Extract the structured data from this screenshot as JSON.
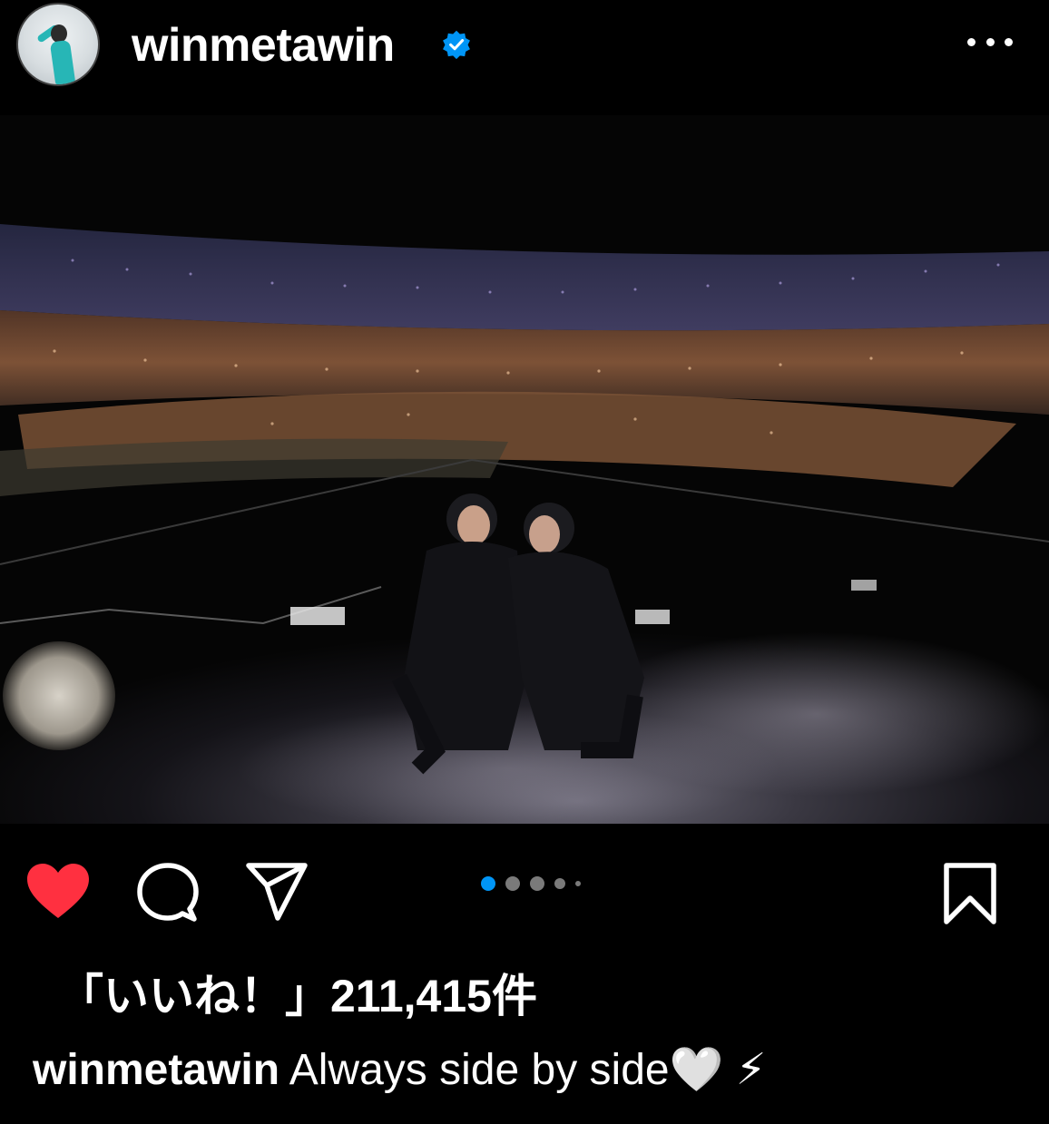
{
  "header": {
    "username": "winmetawin",
    "verified_icon": "verified-badge-icon",
    "more_icon": "more-horizontal-icon"
  },
  "post": {
    "image_alt": "Two performers crouching on a concert stage in front of a crowded arena with lightsticks",
    "carousel": {
      "total": 5,
      "active": 1
    }
  },
  "actions": {
    "like_icon": "heart-filled-icon",
    "comment_icon": "comment-icon",
    "share_icon": "paper-plane-icon",
    "save_icon": "bookmark-icon",
    "like_color": "#ff3040",
    "active_dot_color": "#0095f6"
  },
  "likes": {
    "text": "「いいね！」211,415件"
  },
  "caption": {
    "username": "winmetawin",
    "text": "Always side by side🤍 ⚡"
  }
}
